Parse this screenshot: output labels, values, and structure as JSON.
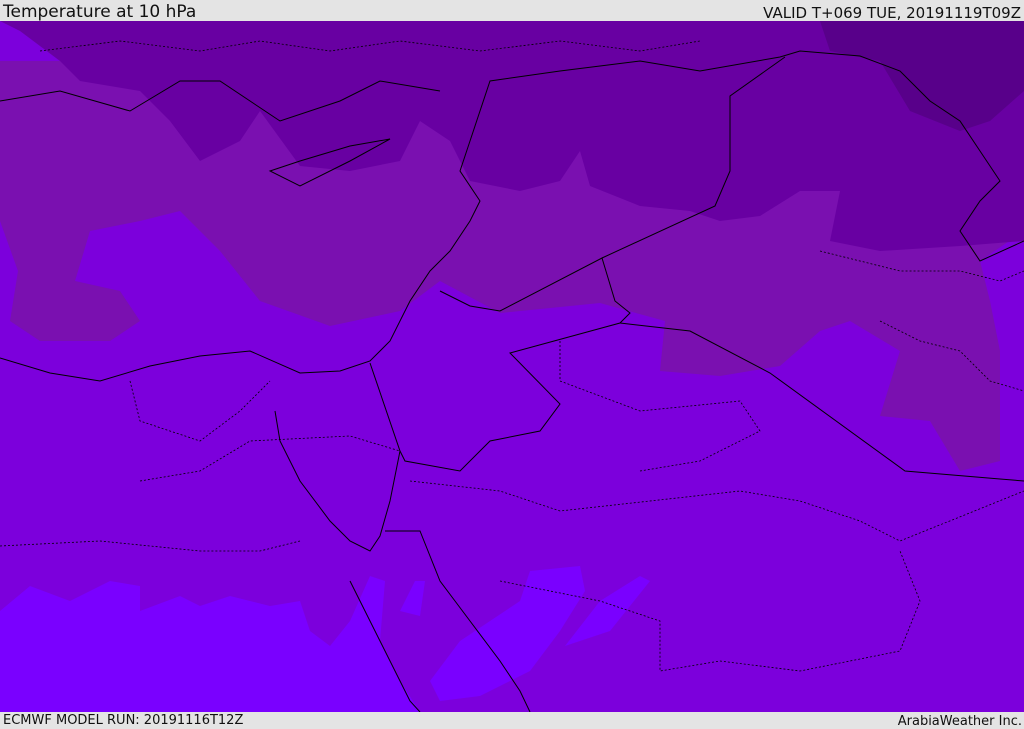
{
  "header": {
    "title": "Temperature at 10 hPa",
    "valid_time": "VALID T+069 TUE, 20191119T09Z"
  },
  "footer": {
    "model_run": "ECMWF MODEL RUN: 20191116T12Z",
    "credit": "ArabiaWeather Inc."
  },
  "map": {
    "field": "temperature",
    "level": "10 hPa",
    "colors": {
      "base": "#7c00dc",
      "warm_band": "#7a10b0",
      "cold_north": "#6800a2",
      "coldest_northeast": "#58008a",
      "bright_south": "#7a00ff",
      "border": "#000000"
    }
  }
}
